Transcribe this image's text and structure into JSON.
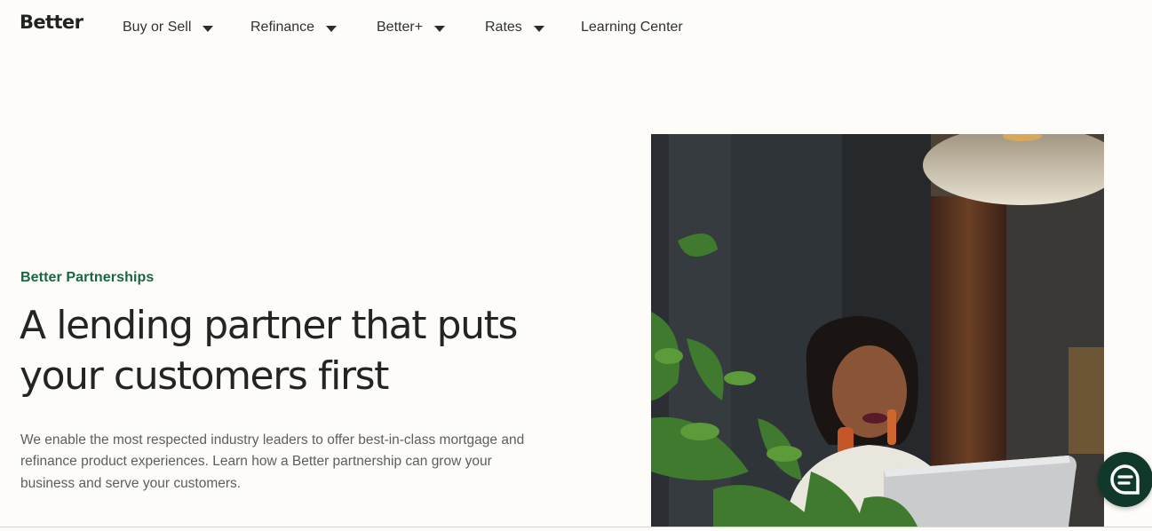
{
  "brand": {
    "logo_text": "Better",
    "accent_color": "#176644",
    "chat_color": "#10392c"
  },
  "nav": {
    "items": [
      {
        "label": "Buy or Sell",
        "has_dropdown": true
      },
      {
        "label": "Refinance",
        "has_dropdown": true
      },
      {
        "label": "Better+",
        "has_dropdown": true
      },
      {
        "label": "Rates",
        "has_dropdown": true
      },
      {
        "label": "Learning Center",
        "has_dropdown": false
      }
    ]
  },
  "hero": {
    "eyebrow": "Better Partnerships",
    "headline_line1": "A lending partner that puts",
    "headline_line2": "your customers first",
    "body": "We enable the most respected industry leaders to offer best-in-class mortgage and refinance product experiences. Learn how a Better partnership can grow your business and serve your customers."
  },
  "icons": {
    "dropdown": "caret-down-icon",
    "chat": "chat-bubble-icon"
  }
}
